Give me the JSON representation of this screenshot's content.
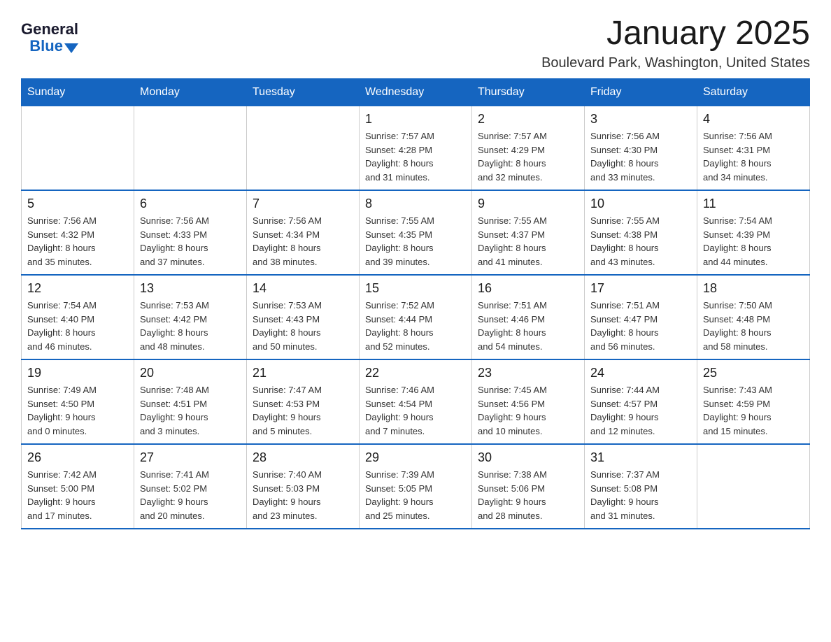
{
  "logo": {
    "general": "General",
    "blue": "Blue"
  },
  "title": "January 2025",
  "location": "Boulevard Park, Washington, United States",
  "days_of_week": [
    "Sunday",
    "Monday",
    "Tuesday",
    "Wednesday",
    "Thursday",
    "Friday",
    "Saturday"
  ],
  "weeks": [
    [
      {
        "day": "",
        "info": ""
      },
      {
        "day": "",
        "info": ""
      },
      {
        "day": "",
        "info": ""
      },
      {
        "day": "1",
        "info": "Sunrise: 7:57 AM\nSunset: 4:28 PM\nDaylight: 8 hours\nand 31 minutes."
      },
      {
        "day": "2",
        "info": "Sunrise: 7:57 AM\nSunset: 4:29 PM\nDaylight: 8 hours\nand 32 minutes."
      },
      {
        "day": "3",
        "info": "Sunrise: 7:56 AM\nSunset: 4:30 PM\nDaylight: 8 hours\nand 33 minutes."
      },
      {
        "day": "4",
        "info": "Sunrise: 7:56 AM\nSunset: 4:31 PM\nDaylight: 8 hours\nand 34 minutes."
      }
    ],
    [
      {
        "day": "5",
        "info": "Sunrise: 7:56 AM\nSunset: 4:32 PM\nDaylight: 8 hours\nand 35 minutes."
      },
      {
        "day": "6",
        "info": "Sunrise: 7:56 AM\nSunset: 4:33 PM\nDaylight: 8 hours\nand 37 minutes."
      },
      {
        "day": "7",
        "info": "Sunrise: 7:56 AM\nSunset: 4:34 PM\nDaylight: 8 hours\nand 38 minutes."
      },
      {
        "day": "8",
        "info": "Sunrise: 7:55 AM\nSunset: 4:35 PM\nDaylight: 8 hours\nand 39 minutes."
      },
      {
        "day": "9",
        "info": "Sunrise: 7:55 AM\nSunset: 4:37 PM\nDaylight: 8 hours\nand 41 minutes."
      },
      {
        "day": "10",
        "info": "Sunrise: 7:55 AM\nSunset: 4:38 PM\nDaylight: 8 hours\nand 43 minutes."
      },
      {
        "day": "11",
        "info": "Sunrise: 7:54 AM\nSunset: 4:39 PM\nDaylight: 8 hours\nand 44 minutes."
      }
    ],
    [
      {
        "day": "12",
        "info": "Sunrise: 7:54 AM\nSunset: 4:40 PM\nDaylight: 8 hours\nand 46 minutes."
      },
      {
        "day": "13",
        "info": "Sunrise: 7:53 AM\nSunset: 4:42 PM\nDaylight: 8 hours\nand 48 minutes."
      },
      {
        "day": "14",
        "info": "Sunrise: 7:53 AM\nSunset: 4:43 PM\nDaylight: 8 hours\nand 50 minutes."
      },
      {
        "day": "15",
        "info": "Sunrise: 7:52 AM\nSunset: 4:44 PM\nDaylight: 8 hours\nand 52 minutes."
      },
      {
        "day": "16",
        "info": "Sunrise: 7:51 AM\nSunset: 4:46 PM\nDaylight: 8 hours\nand 54 minutes."
      },
      {
        "day": "17",
        "info": "Sunrise: 7:51 AM\nSunset: 4:47 PM\nDaylight: 8 hours\nand 56 minutes."
      },
      {
        "day": "18",
        "info": "Sunrise: 7:50 AM\nSunset: 4:48 PM\nDaylight: 8 hours\nand 58 minutes."
      }
    ],
    [
      {
        "day": "19",
        "info": "Sunrise: 7:49 AM\nSunset: 4:50 PM\nDaylight: 9 hours\nand 0 minutes."
      },
      {
        "day": "20",
        "info": "Sunrise: 7:48 AM\nSunset: 4:51 PM\nDaylight: 9 hours\nand 3 minutes."
      },
      {
        "day": "21",
        "info": "Sunrise: 7:47 AM\nSunset: 4:53 PM\nDaylight: 9 hours\nand 5 minutes."
      },
      {
        "day": "22",
        "info": "Sunrise: 7:46 AM\nSunset: 4:54 PM\nDaylight: 9 hours\nand 7 minutes."
      },
      {
        "day": "23",
        "info": "Sunrise: 7:45 AM\nSunset: 4:56 PM\nDaylight: 9 hours\nand 10 minutes."
      },
      {
        "day": "24",
        "info": "Sunrise: 7:44 AM\nSunset: 4:57 PM\nDaylight: 9 hours\nand 12 minutes."
      },
      {
        "day": "25",
        "info": "Sunrise: 7:43 AM\nSunset: 4:59 PM\nDaylight: 9 hours\nand 15 minutes."
      }
    ],
    [
      {
        "day": "26",
        "info": "Sunrise: 7:42 AM\nSunset: 5:00 PM\nDaylight: 9 hours\nand 17 minutes."
      },
      {
        "day": "27",
        "info": "Sunrise: 7:41 AM\nSunset: 5:02 PM\nDaylight: 9 hours\nand 20 minutes."
      },
      {
        "day": "28",
        "info": "Sunrise: 7:40 AM\nSunset: 5:03 PM\nDaylight: 9 hours\nand 23 minutes."
      },
      {
        "day": "29",
        "info": "Sunrise: 7:39 AM\nSunset: 5:05 PM\nDaylight: 9 hours\nand 25 minutes."
      },
      {
        "day": "30",
        "info": "Sunrise: 7:38 AM\nSunset: 5:06 PM\nDaylight: 9 hours\nand 28 minutes."
      },
      {
        "day": "31",
        "info": "Sunrise: 7:37 AM\nSunset: 5:08 PM\nDaylight: 9 hours\nand 31 minutes."
      },
      {
        "day": "",
        "info": ""
      }
    ]
  ]
}
